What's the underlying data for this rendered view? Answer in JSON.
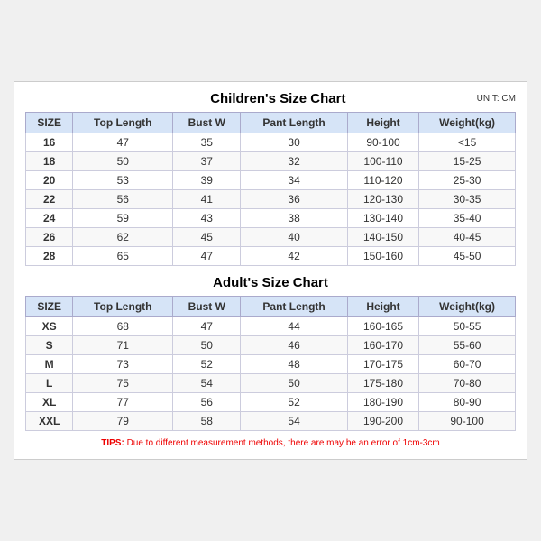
{
  "page": {
    "children_title": "Children's Size Chart",
    "adult_title": "Adult's Size Chart",
    "unit": "UNIT: CM",
    "tips": "TIPS: Due to different measurement methods, there are may be an error of 1cm-3cm",
    "headers": [
      "SIZE",
      "Top Length",
      "Bust W",
      "Pant Length",
      "Height",
      "Weight(kg)"
    ],
    "children_rows": [
      [
        "16",
        "47",
        "35",
        "30",
        "90-100",
        "<15"
      ],
      [
        "18",
        "50",
        "37",
        "32",
        "100-110",
        "15-25"
      ],
      [
        "20",
        "53",
        "39",
        "34",
        "110-120",
        "25-30"
      ],
      [
        "22",
        "56",
        "41",
        "36",
        "120-130",
        "30-35"
      ],
      [
        "24",
        "59",
        "43",
        "38",
        "130-140",
        "35-40"
      ],
      [
        "26",
        "62",
        "45",
        "40",
        "140-150",
        "40-45"
      ],
      [
        "28",
        "65",
        "47",
        "42",
        "150-160",
        "45-50"
      ]
    ],
    "adult_rows": [
      [
        "XS",
        "68",
        "47",
        "44",
        "160-165",
        "50-55"
      ],
      [
        "S",
        "71",
        "50",
        "46",
        "160-170",
        "55-60"
      ],
      [
        "M",
        "73",
        "52",
        "48",
        "170-175",
        "60-70"
      ],
      [
        "L",
        "75",
        "54",
        "50",
        "175-180",
        "70-80"
      ],
      [
        "XL",
        "77",
        "56",
        "52",
        "180-190",
        "80-90"
      ],
      [
        "XXL",
        "79",
        "58",
        "54",
        "190-200",
        "90-100"
      ]
    ]
  }
}
